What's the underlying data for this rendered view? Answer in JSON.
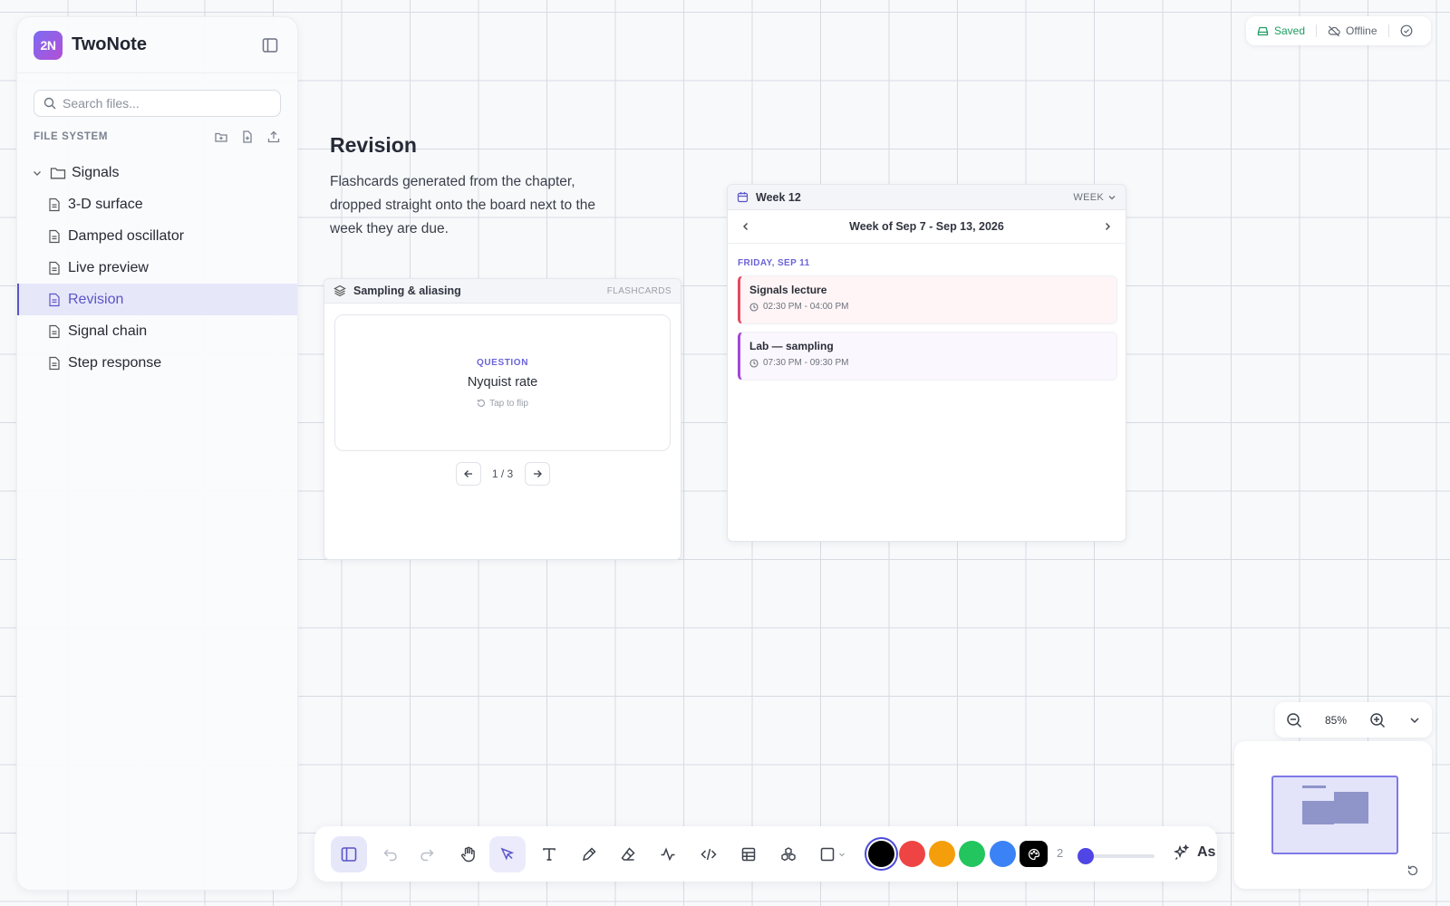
{
  "app": {
    "title": "TwoNote",
    "logo_text": "2N"
  },
  "sidebar": {
    "search_placeholder": "Search files...",
    "section_label": "FILE SYSTEM",
    "folder": {
      "label": "Signals",
      "expanded": true
    },
    "files": [
      {
        "label": "3-D surface",
        "active": false
      },
      {
        "label": "Damped oscillator",
        "active": false
      },
      {
        "label": "Live preview",
        "active": false
      },
      {
        "label": "Revision",
        "active": true
      },
      {
        "label": "Signal chain",
        "active": false
      },
      {
        "label": "Step response",
        "active": false
      }
    ]
  },
  "status": {
    "saved": "Saved",
    "offline": "Offline"
  },
  "board": {
    "title": "Revision",
    "description": "Flashcards generated from the chapter, dropped straight onto the board next to the week they are due."
  },
  "flashcards": {
    "title": "Sampling & aliasing",
    "tag": "FLASHCARDS",
    "side_label": "QUESTION",
    "term": "Nyquist rate",
    "hint": "Tap to flip",
    "position": "1 / 3"
  },
  "calendar": {
    "title": "Week 12",
    "view": "WEEK",
    "range": "Week of Sep 7 - Sep 13, 2026",
    "day_label": "FRIDAY, SEP 11",
    "events": [
      {
        "title": "Signals lecture",
        "time": "02:30 PM - 04:00 PM",
        "color": "#e44a63"
      },
      {
        "title": "Lab — sampling",
        "time": "07:30 PM - 09:30 PM",
        "color": "#a446d8"
      }
    ]
  },
  "zoom": {
    "value": "85%"
  },
  "toolbar": {
    "colors": [
      "#000000",
      "#ef4444",
      "#f59e0b",
      "#22c55e",
      "#3b82f6"
    ],
    "selected_color": "#000000",
    "stroke_width": "2",
    "ask_label": "As"
  },
  "theme": {
    "accent": "#5a55c8",
    "saved_color": "#1f9d63"
  }
}
